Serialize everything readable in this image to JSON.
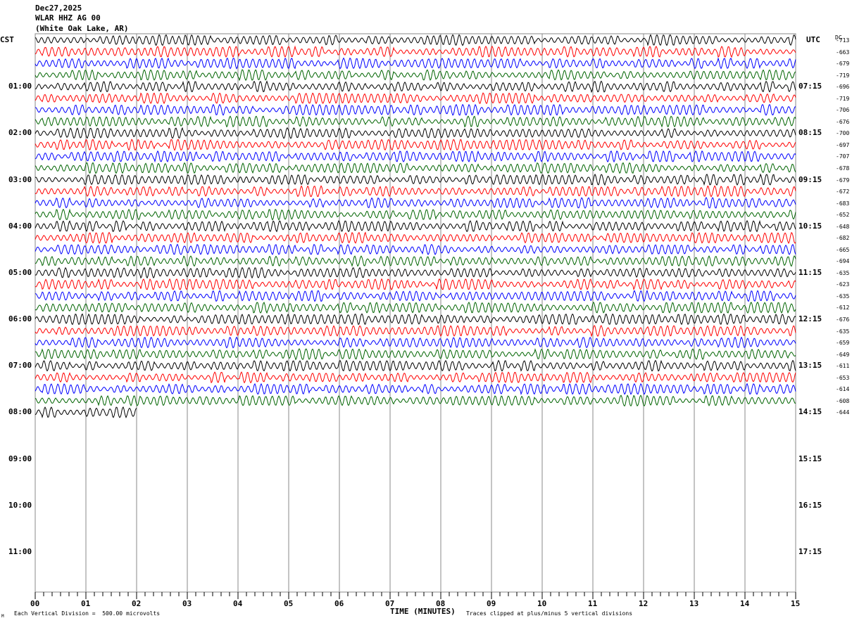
{
  "header": {
    "date": "Dec27,2025",
    "station": "WLAR HHZ AG 00",
    "location": "(White Oak Lake, AR)"
  },
  "left_zone": "CST",
  "right_zone": "UTC",
  "dc_label": "DC",
  "footer": {
    "scale_note": "Each Vertical Division =  500.00 microvolts",
    "xlabel": "TIME (MINUTES)",
    "clip_note": "Traces clipped at plus/minus 5 vertical divisions",
    "corner_mark": "M"
  },
  "chart_data": {
    "type": "line",
    "subtype": "helicorder",
    "xlabel": "TIME (MINUTES)",
    "xlim": [
      0,
      15
    ],
    "x_ticks": [
      "00",
      "01",
      "02",
      "03",
      "04",
      "05",
      "06",
      "07",
      "08",
      "09",
      "10",
      "11",
      "12",
      "13",
      "14",
      "15"
    ],
    "minor_ticks_per_minute": 6,
    "left_hour_labels": [
      "01:00",
      "02:00",
      "03:00",
      "04:00",
      "05:00",
      "06:00",
      "07:00",
      "08:00",
      "09:00",
      "10:00",
      "11:00"
    ],
    "right_hour_labels": [
      "07:15",
      "08:15",
      "09:15",
      "10:15",
      "11:15",
      "12:15",
      "13:15",
      "14:15",
      "15:15",
      "16:15",
      "17:15"
    ],
    "rows_per_hour": 4,
    "total_rows": 48,
    "trace_colors": [
      "#000000",
      "#ff0000",
      "#0000ff",
      "#006400"
    ],
    "dc_offsets": [
      -713,
      -663,
      -679,
      -719,
      -696,
      -719,
      -706,
      -676,
      -700,
      -697,
      -707,
      -678,
      -679,
      -672,
      -683,
      -652,
      -648,
      -682,
      -665,
      -694,
      -635,
      -623,
      -635,
      -612,
      -676,
      -635,
      -659,
      -649,
      -611,
      -653,
      -614,
      -608,
      -644
    ],
    "last_trace_end_minute": 2,
    "grid": true
  }
}
